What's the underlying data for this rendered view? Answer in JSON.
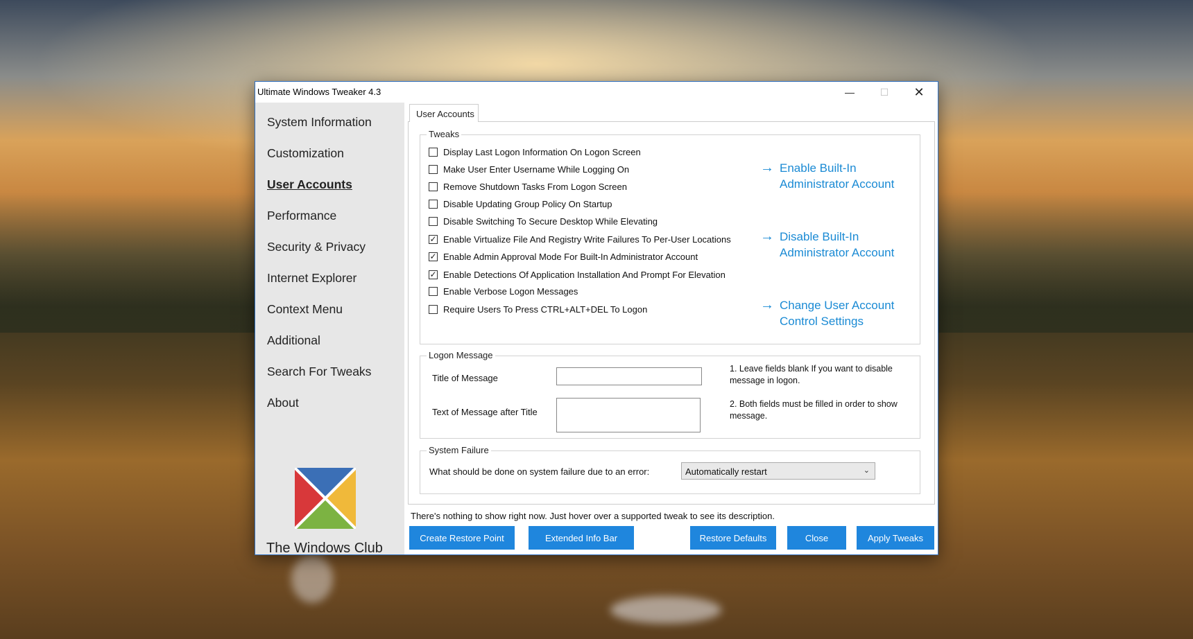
{
  "window": {
    "title": "Ultimate Windows Tweaker 4.3",
    "minimize_glyph": "—",
    "maximize_glyph": "☐",
    "close_glyph": "✕"
  },
  "sidebar": {
    "items": [
      {
        "label": "System Information"
      },
      {
        "label": "Customization"
      },
      {
        "label": "User Accounts",
        "active": true
      },
      {
        "label": "Performance"
      },
      {
        "label": "Security & Privacy"
      },
      {
        "label": "Internet Explorer"
      },
      {
        "label": "Context Menu"
      },
      {
        "label": "Additional"
      },
      {
        "label": "Search For Tweaks"
      },
      {
        "label": "About"
      }
    ],
    "logo_text": "The Windows Club",
    "logo_colors": {
      "top": "#3b6fb6",
      "right": "#f0b93a",
      "bottom": "#7cb342",
      "left": "#d8383a"
    }
  },
  "tab": {
    "label": "User Accounts"
  },
  "tweaks": {
    "title": "Tweaks",
    "items": [
      {
        "label": "Display Last Logon Information On Logon Screen",
        "checked": false
      },
      {
        "label": "Make User Enter Username While Logging On",
        "checked": false
      },
      {
        "label": "Remove Shutdown Tasks From Logon Screen",
        "checked": false
      },
      {
        "label": "Disable Updating Group Policy On Startup",
        "checked": false
      },
      {
        "label": "Disable Switching To Secure Desktop While Elevating",
        "checked": false
      },
      {
        "label": "Enable Virtualize File And Registry Write Failures To Per-User Locations",
        "checked": true
      },
      {
        "label": "Enable Admin Approval Mode For Built-In Administrator Account",
        "checked": true
      },
      {
        "label": "Enable Detections Of Application Installation And Prompt For Elevation",
        "checked": true
      },
      {
        "label": "Enable Verbose Logon Messages",
        "checked": false
      },
      {
        "label": "Require Users To Press CTRL+ALT+DEL To Logon",
        "checked": false
      }
    ],
    "check_glyph": "✓",
    "arrow_glyph": "→",
    "links": [
      {
        "line1": "Enable Built-In",
        "line2": "Administrator Account"
      },
      {
        "line1": "Disable Built-In",
        "line2": "Administrator Account"
      },
      {
        "line1": "Change User Account",
        "line2": "Control Settings"
      }
    ]
  },
  "logon_message": {
    "title": "Logon Message",
    "title_label": "Title of Message",
    "text_label": "Text of Message after Title",
    "title_value": "",
    "text_value": "",
    "note1": "1. Leave fields blank If you want to disable message in logon.",
    "note2": "2. Both fields must be filled in order to show message."
  },
  "system_failure": {
    "title": "System Failure",
    "label": "What should be done on system failure due to an error:",
    "selected": "Automatically restart",
    "chevron_glyph": "⌄"
  },
  "status_text": "There's nothing to show right now. Just hover over a supported tweak to see its description.",
  "buttons": {
    "create_restore_point": "Create Restore Point",
    "extended_info_bar": "Extended Info Bar",
    "restore_defaults": "Restore Defaults",
    "close": "Close",
    "apply_tweaks": "Apply Tweaks"
  },
  "colors": {
    "accent": "#1f86dd",
    "link": "#1a8ad4",
    "sidebar_bg": "#e7e7e7"
  }
}
